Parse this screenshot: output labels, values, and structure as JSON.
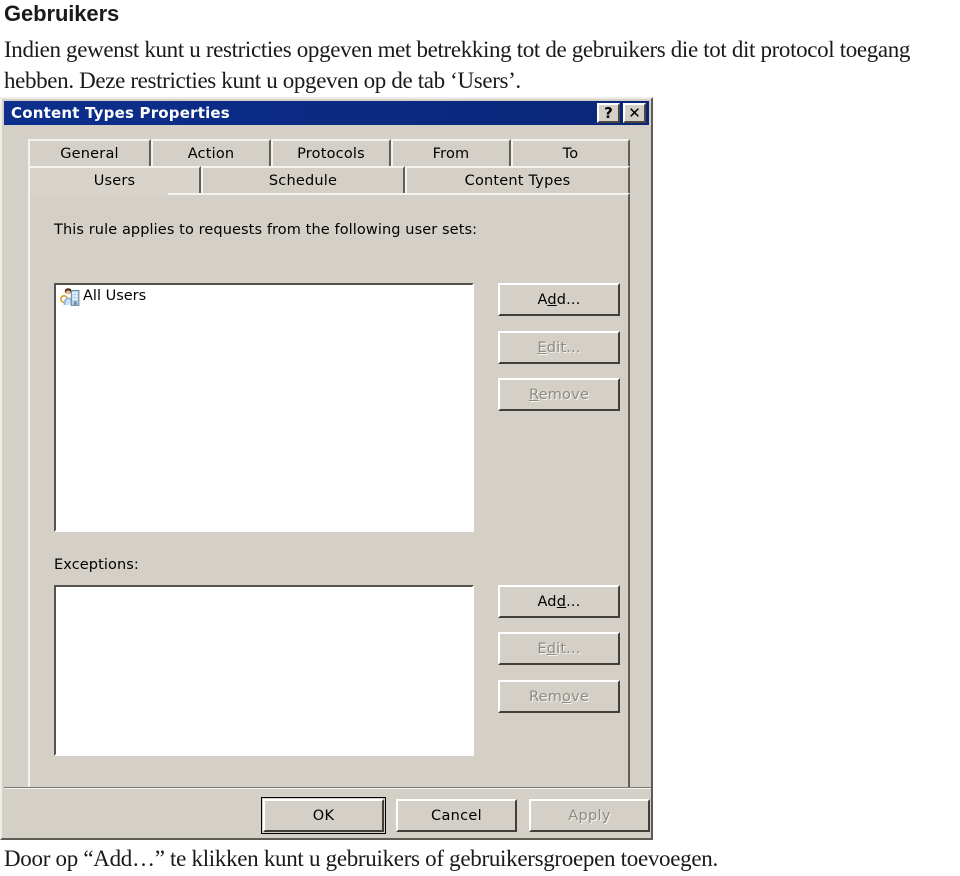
{
  "document": {
    "heading": "Gebruikers",
    "paragraph": "Indien gewenst kunt u restricties opgeven met betrekking tot de gebruikers die tot dit protocol toegang hebben. Deze restricties kunt u opgeven op de tab ‘Users’.",
    "footer": "Door op “Add…” te klikken kunt u gebruikers of gebruikersgroepen toevoegen."
  },
  "dialog": {
    "title": "Content Types Properties",
    "titlebar_buttons": [
      {
        "name": "help-button",
        "glyph": "?"
      },
      {
        "name": "close-button",
        "glyph": "✕"
      }
    ],
    "tabs_row1": [
      {
        "label": "General",
        "selected": false
      },
      {
        "label": "Action",
        "selected": false
      },
      {
        "label": "Protocols",
        "selected": false
      },
      {
        "label": "From",
        "selected": false
      },
      {
        "label": "To",
        "selected": false
      }
    ],
    "tabs_row2": [
      {
        "label": "Users",
        "selected": true
      },
      {
        "label": "Schedule",
        "selected": false
      },
      {
        "label": "Content Types",
        "selected": false
      }
    ],
    "users_section": {
      "label": "This rule applies to requests from the following user sets:",
      "items": [
        {
          "label": "All Users",
          "icon": "users-group-icon"
        }
      ],
      "buttons": [
        {
          "label_pre": "A",
          "label_accel": "d",
          "label_post": "d...",
          "name": "users-add-button",
          "enabled": true
        },
        {
          "label_pre": "",
          "label_accel": "E",
          "label_post": "dit...",
          "name": "users-edit-button",
          "enabled": false
        },
        {
          "label_pre": "",
          "label_accel": "R",
          "label_post": "emove",
          "name": "users-remove-button",
          "enabled": false
        }
      ]
    },
    "exceptions_section": {
      "label": "Exceptions:",
      "items": [],
      "buttons": [
        {
          "label_pre": "A",
          "label_accel": "d",
          "label_post": "d...",
          "name": "exceptions-add-button",
          "enabled": true
        },
        {
          "label_pre": "E",
          "label_accel": "d",
          "label_post": "it...",
          "name": "exceptions-edit-button",
          "enabled": false
        },
        {
          "label_pre": "R",
          "label_accel": "emo",
          "label_post": "ve",
          "name": "exceptions-remove-button",
          "enabled": false
        }
      ]
    },
    "footer_buttons": [
      {
        "label": "OK",
        "name": "ok-button",
        "enabled": true,
        "default": true
      },
      {
        "label": "Cancel",
        "name": "cancel-button",
        "enabled": true,
        "default": false
      },
      {
        "label": "Apply",
        "name": "apply-button",
        "enabled": false,
        "default": false
      }
    ]
  },
  "colors": {
    "titlebar": "#0a2a80",
    "dialog_face": "#d4d0c8",
    "disabled_text": "#8d8a84",
    "page_background": "#ffffff"
  }
}
